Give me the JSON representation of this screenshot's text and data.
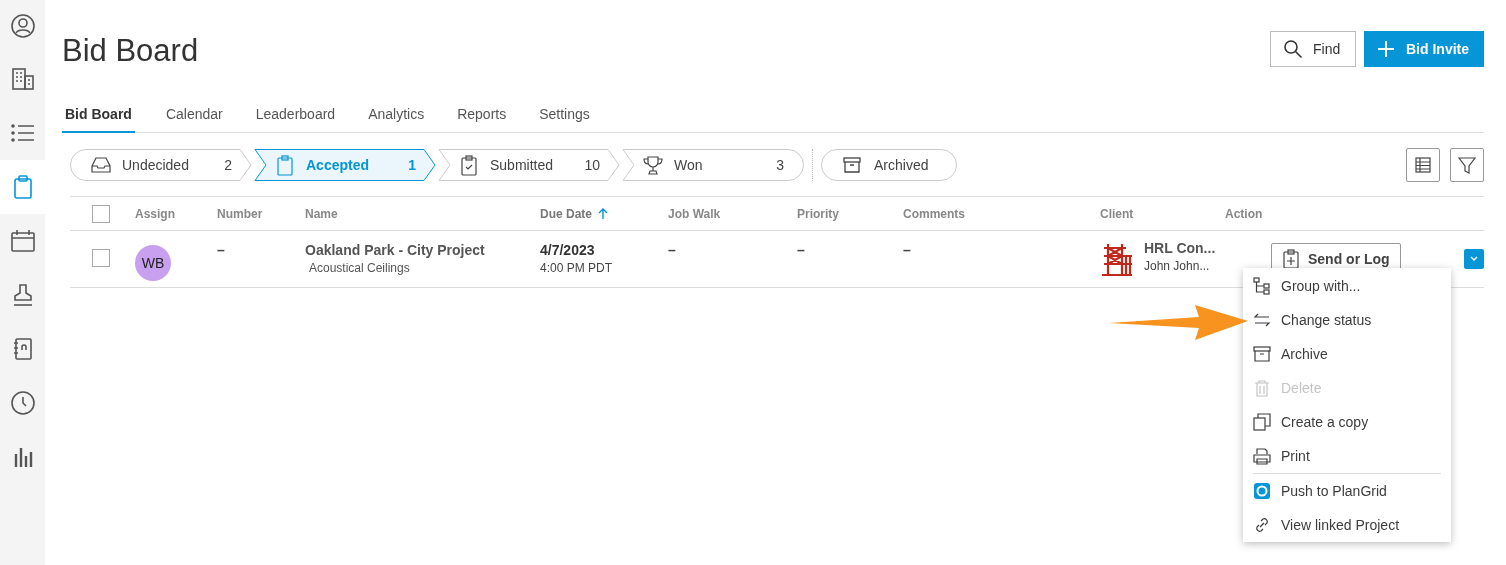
{
  "sidebar": {
    "items": [
      {
        "kind": "user",
        "selected": false
      },
      {
        "kind": "building",
        "selected": false
      },
      {
        "kind": "list",
        "selected": false
      },
      {
        "kind": "clipboard",
        "selected": true
      },
      {
        "kind": "calendar",
        "selected": false
      },
      {
        "kind": "stamp",
        "selected": false
      },
      {
        "kind": "notebook",
        "selected": false
      },
      {
        "kind": "clock",
        "selected": false
      },
      {
        "kind": "chart",
        "selected": false
      }
    ]
  },
  "title": "Bid Board",
  "header_buttons": {
    "find": "Find",
    "bid_invite": "Bid Invite"
  },
  "tabs": [
    {
      "label": "Bid Board",
      "selected": true
    },
    {
      "label": "Calendar",
      "selected": false
    },
    {
      "label": "Leaderboard",
      "selected": false
    },
    {
      "label": "Analytics",
      "selected": false
    },
    {
      "label": "Reports",
      "selected": false
    },
    {
      "label": "Settings",
      "selected": false
    }
  ],
  "stages": [
    {
      "kind": "tray",
      "label": "Undecided",
      "count": "2",
      "selected": false
    },
    {
      "kind": "clipboard",
      "label": "Accepted",
      "count": "1",
      "selected": true
    },
    {
      "kind": "checklist",
      "label": "Submitted",
      "count": "10",
      "selected": false
    },
    {
      "kind": "trophy",
      "label": "Won",
      "count": "3",
      "selected": false
    }
  ],
  "archived": {
    "label": "Archived",
    "selected": false
  },
  "table": {
    "select_all": {
      "checked": false
    },
    "columns": [
      {
        "label": "Assign",
        "kind": "text",
        "sorted": false
      },
      {
        "label": "Number",
        "kind": "text",
        "sorted": false
      },
      {
        "label": "Name",
        "kind": "text",
        "sorted": false
      },
      {
        "label": "Due Date",
        "kind": "text",
        "sorted": true
      },
      {
        "label": "Job Walk",
        "kind": "text",
        "sorted": false
      },
      {
        "label": "Priority",
        "kind": "text",
        "sorted": false
      },
      {
        "label": "Comments",
        "kind": "text",
        "sorted": false
      },
      {
        "label": "Client",
        "kind": "text",
        "sorted": false
      },
      {
        "label": "Action",
        "kind": "text",
        "sorted": false
      }
    ],
    "rows": [
      {
        "checked": false,
        "assign": "WB",
        "number": "–",
        "name": "Oakland Park - City Project",
        "trade": "Acoustical Ceilings",
        "due_date": "4/7/2023",
        "due_time": "4:00 PM PDT",
        "job_walk": "–",
        "priority": "–",
        "comments": "–",
        "client": "HRL Con...",
        "contact": "John John...",
        "action": "Send or Log"
      }
    ]
  },
  "menu": {
    "groups": [
      [
        {
          "kind": "group",
          "label": "Group with...",
          "disabled": false
        },
        {
          "kind": "swap",
          "label": "Change status",
          "disabled": false
        },
        {
          "kind": "archive",
          "label": "Archive",
          "disabled": false
        },
        {
          "kind": "trash",
          "label": "Delete",
          "disabled": true
        },
        {
          "kind": "copy",
          "label": "Create a copy",
          "disabled": false
        },
        {
          "kind": "print",
          "label": "Print",
          "disabled": false
        }
      ],
      [
        {
          "kind": "plangrid",
          "label": "Push to PlanGrid",
          "disabled": false
        },
        {
          "kind": "link",
          "label": "View linked Project",
          "disabled": false
        }
      ]
    ]
  }
}
